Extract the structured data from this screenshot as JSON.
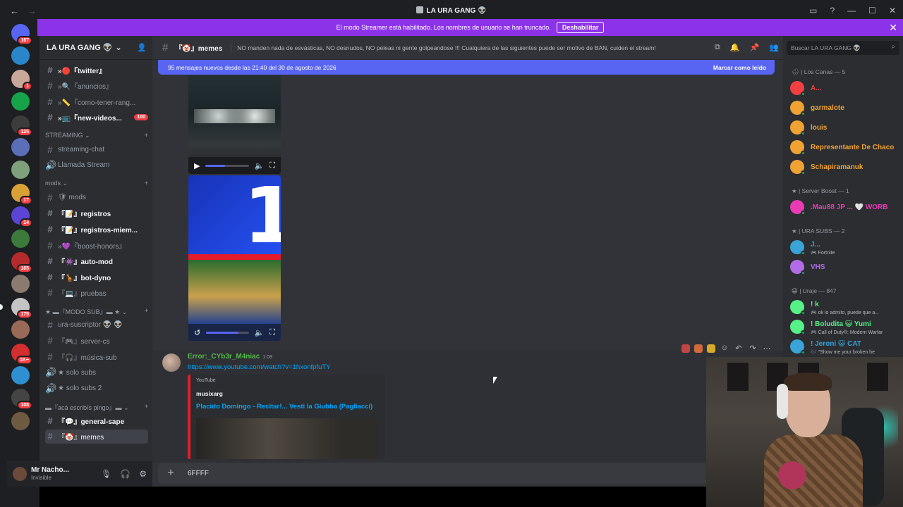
{
  "window": {
    "title": "LA URA GANG 👽",
    "nav_back": "←",
    "nav_forward": "→",
    "controls": [
      "▭",
      "?",
      "—",
      "☐",
      "✕"
    ]
  },
  "banner": {
    "text": "El modo Streamer está habilitado. Los nombres de usuario se han truncado.",
    "button": "Deshabilitar",
    "close": "✕"
  },
  "rail": {
    "servers": [
      {
        "color": "#5865f2",
        "badge": "167"
      },
      {
        "color": "#2a86c9",
        "badge": ""
      },
      {
        "color": "#c8a899",
        "badge": "1"
      },
      {
        "color": "#17a34a",
        "badge": ""
      },
      {
        "color": "#3c3c3c",
        "badge": "125"
      },
      {
        "color": "#5b6fb8",
        "badge": ""
      },
      {
        "color": "#7ea07a",
        "badge": ""
      },
      {
        "color": "#d9a036",
        "badge": "17"
      },
      {
        "color": "#5b44d6",
        "badge": "14"
      },
      {
        "color": "#3c7a3c",
        "badge": ""
      },
      {
        "color": "#b52a2a",
        "badge": "165"
      },
      {
        "color": "#8a7a70",
        "badge": ""
      },
      {
        "color": "#c4c4c4",
        "badge": "175"
      },
      {
        "color": "#9a6a58",
        "badge": ""
      },
      {
        "color": "#d32f2f",
        "badge": "1K+"
      },
      {
        "color": "#2e8fd1",
        "badge": ""
      },
      {
        "color": "#444",
        "badge": "108"
      },
      {
        "color": "#6d5a40",
        "badge": ""
      }
    ]
  },
  "sidebar": {
    "guild_name": "LA URA GANG 👽",
    "channels": [
      {
        "icon": "#",
        "name": "»🔴『twitter』",
        "style": "unread",
        "badge": ""
      },
      {
        "icon": "#",
        "name": "»🔍『anuncios』",
        "style": "",
        "badge": ""
      },
      {
        "icon": "#",
        "name": "»📏『como-tener-rang...",
        "style": "",
        "badge": ""
      },
      {
        "icon": "#",
        "name": "»📺『new-videos...",
        "style": "unread",
        "badge": "100"
      },
      {
        "icon": "",
        "name": "STREAMING ⌄",
        "style": "cat",
        "badge": ""
      },
      {
        "icon": "#",
        "name": "streaming-chat",
        "style": "",
        "badge": ""
      },
      {
        "icon": "🔊",
        "name": "Llamada Stream",
        "style": "",
        "badge": ""
      },
      {
        "icon": "",
        "name": "mods ⌄",
        "style": "cat",
        "badge": ""
      },
      {
        "icon": "#",
        "name": "🛡 mods",
        "style": "",
        "badge": ""
      },
      {
        "icon": "#",
        "name": "『📝』registros",
        "style": "unread",
        "badge": ""
      },
      {
        "icon": "#",
        "name": "『📝』registros-miem...",
        "style": "unread",
        "badge": ""
      },
      {
        "icon": "#",
        "name": "»💜『boost-honors』",
        "style": "",
        "badge": ""
      },
      {
        "icon": "#",
        "name": "『👾』auto-mod",
        "style": "unread",
        "badge": ""
      },
      {
        "icon": "#",
        "name": "『🦒』bot-dyno",
        "style": "unread",
        "badge": ""
      },
      {
        "icon": "#",
        "name": "『💻』pruebas",
        "style": "",
        "badge": ""
      },
      {
        "icon": "",
        "name": "★ ▬『MODO SUB』▬ ★ ⌄",
        "style": "cat",
        "badge": ""
      },
      {
        "icon": "#",
        "name": "ura-suscriptor 👽 👽",
        "style": "",
        "badge": ""
      },
      {
        "icon": "#",
        "name": "『🎮』server-cs",
        "style": "",
        "badge": ""
      },
      {
        "icon": "#",
        "name": "『🎧』música-sub",
        "style": "",
        "badge": ""
      },
      {
        "icon": "🔊",
        "name": "★ solo subs",
        "style": "",
        "badge": ""
      },
      {
        "icon": "🔊",
        "name": "★ solo subs 2",
        "style": "",
        "badge": ""
      },
      {
        "icon": "",
        "name": "▬『acá escribís pingo』▬ ⌄",
        "style": "cat",
        "badge": ""
      },
      {
        "icon": "#",
        "name": "『💬』general-sape",
        "style": "unread",
        "badge": ""
      },
      {
        "icon": "#",
        "name": "『🤡』memes",
        "style": "active",
        "badge": ""
      }
    ],
    "add_symbol": "+",
    "user": {
      "name": "Mr Nacho...",
      "status": "Invisible"
    }
  },
  "channel": {
    "name": "『🤡』memes",
    "topic": "NO manden nada de esvásticas, NO desnudos, NO peleas ni gente golpeandose !!! Cualquiera de las siguientes puede ser motivo de BAN, cuiden el stream!",
    "new_messages": "95 mensajes nuevos desde las 21:40 del 30 de agosto de 2026",
    "mark_read": "Marcar como leído",
    "video1_progress": 0.45,
    "video2_progress": 0.75
  },
  "message": {
    "author": "Error:_CYb3r_M4niac",
    "time": "1:08",
    "link": "https://www.youtube.com/watch?v=1hxonfpfuTY",
    "embed_provider": "YouTube",
    "embed_author": "musixarg",
    "embed_title": "Placido Domingo - Recitar!... Vesti la Giubba (Pagliacci)"
  },
  "composer": {
    "text": "6FFFF"
  },
  "members": {
    "search_placeholder": "Buscar LA URA GANG 👽",
    "groups": [
      {
        "title": "🌧 | Los Canas — 5",
        "items": [
          {
            "name": "A...",
            "color": "#f23f43",
            "sub": ""
          },
          {
            "name": "garmalote",
            "color": "#f0a232",
            "sub": ""
          },
          {
            "name": "louis",
            "color": "#f0a232",
            "sub": ""
          },
          {
            "name": "Representante De Chaco",
            "color": "#f0a232",
            "sub": ""
          },
          {
            "name": "Schapiramanuk",
            "color": "#f0a232",
            "sub": ""
          }
        ]
      },
      {
        "title": "★ | Server Boost — 1",
        "items": [
          {
            "name": ".Mau88 JP ...  🤍 WORB",
            "color": "#e83bb4",
            "sub": ""
          }
        ]
      },
      {
        "title": "★ | URA SUBS — 2",
        "items": [
          {
            "name": "J...",
            "color": "#3aa3d8",
            "sub": "🎮 Fortnite"
          },
          {
            "name": "VHS",
            "color": "#b36be6",
            "sub": ""
          }
        ]
      },
      {
        "title": "😀 | Uraje — 847",
        "items": [
          {
            "name": "! k",
            "color": "#57f287",
            "sub": "🎮 ok lo admito, puede que a..."
          },
          {
            "name": "! Boludita  😺 Yumi",
            "color": "#57f287",
            "sub": "🎮 Call of Duty®: Modern Warfar"
          },
          {
            "name": "! Jeroni  😺 CAT",
            "color": "#3aa3d8",
            "sub": "🎶 \"Show me your broken he"
          }
        ]
      }
    ]
  }
}
